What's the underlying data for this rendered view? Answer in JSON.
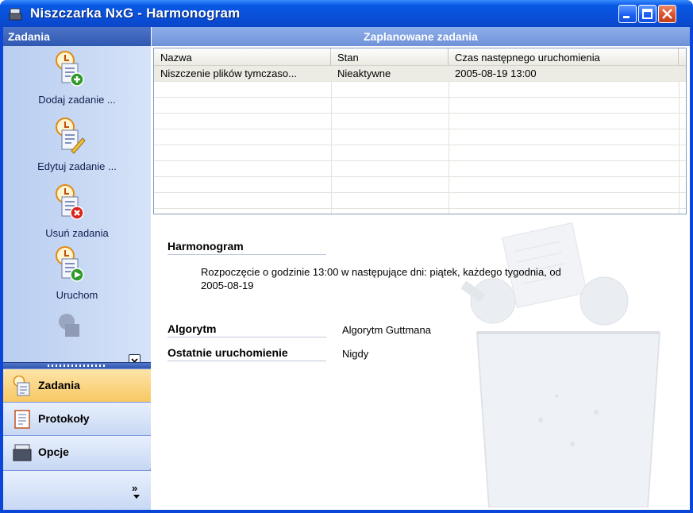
{
  "window": {
    "title": "Niszczarka NxG - Harmonogram",
    "controls": [
      "minimize",
      "maximize",
      "close"
    ]
  },
  "sidebar": {
    "header": "Zadania",
    "tasks": [
      {
        "label": "Dodaj zadanie ...",
        "icon": "add-task-icon"
      },
      {
        "label": "Edytuj zadanie ...",
        "icon": "edit-task-icon"
      },
      {
        "label": "Usuń zadania",
        "icon": "delete-task-icon"
      },
      {
        "label": "Uruchom",
        "icon": "run-task-icon"
      }
    ],
    "nav": [
      {
        "label": "Zadania",
        "icon": "tasks-icon",
        "active": true
      },
      {
        "label": "Protokoły",
        "icon": "logs-icon",
        "active": false
      },
      {
        "label": "Opcje",
        "icon": "options-icon",
        "active": false
      }
    ],
    "more": "»"
  },
  "main": {
    "header": "Zaplanowane zadania",
    "table": {
      "columns": [
        "Nazwa",
        "Stan",
        "Czas następnego uruchomienia"
      ],
      "rows": [
        [
          "Niszczenie plików tymczaso...",
          "Nieaktywne",
          "2005-08-19  13:00"
        ]
      ]
    },
    "details": {
      "schedule_title": "Harmonogram",
      "schedule_text_1": "Rozpoczęcie o godzinie 13:00 w następujące dni: piątek, każdego tygodnia, od",
      "schedule_text_2": "2005-08-19",
      "algorithm_label": "Algorytm",
      "algorithm_value": "Algorytm Guttmana",
      "last_run_label": "Ostatnie uruchomienie",
      "last_run_value": "Nigdy"
    }
  },
  "colors": {
    "titlebar": "#0a4fd8",
    "sidebar_header": "#2f58b2",
    "active_nav": "#f8c864",
    "main_header": "#7f9ee0"
  }
}
